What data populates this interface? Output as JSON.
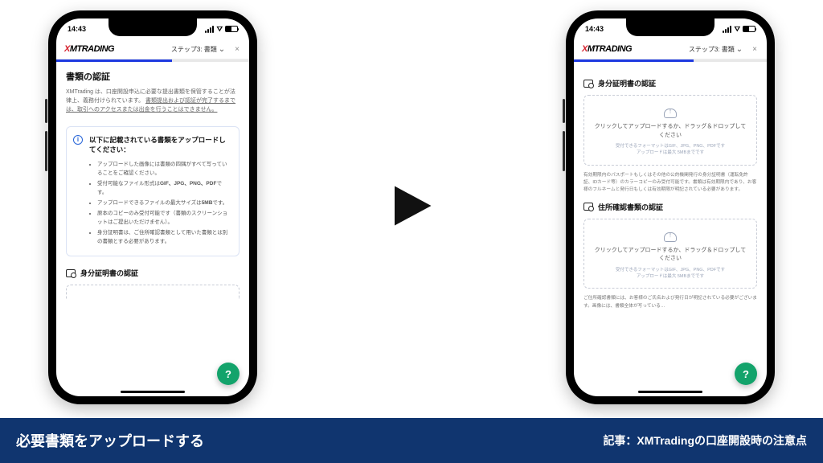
{
  "status": {
    "time": "14:43"
  },
  "header": {
    "brandA": "X",
    "brandB": "MTRADING",
    "step": "ステップ3: 書類",
    "close": "×"
  },
  "progress": {
    "pct1": "60%",
    "pct2": "62%"
  },
  "p1": {
    "title": "書類の認証",
    "lead_a": "XMTrading は、口座開設申込に必要な提出書類を保管することが法律上、義務付けられています。",
    "lead_b": "書類提出および認証が完了するまでは、取引へのアクセスまたは出金を行うことはできません。",
    "info_title": "以下に記載されている書類をアップロードしてください：",
    "b1": "アップロードした画像には書類の四隅がすべて写っていることをご確認ください。",
    "b2_a": "受付可能なファイル形式は",
    "b2_b": "GIF、JPG、PNG、PDF",
    "b2_c": "です。",
    "b3_a": "アップロードできるファイルの最大サイズは",
    "b3_b": "5MB",
    "b3_c": "です。",
    "b4": "原本のコピーのみ受付可能です（書類のスクリーンショットはご提出いただけません）。",
    "b5": "身分証明書は、ご住所確認書類として用いた書類とは別の書類とする必要があります。",
    "section1": "身分証明書の認証"
  },
  "p2": {
    "section1": "身分証明書の認証",
    "drop_label": "クリックしてアップロードするか、ドラッグ＆ドロップしてください",
    "drop_sub": "受付できるフォーマットはGIF、JPG、PNG、PDFです\nアップロードは最大 5MBまでです",
    "note1": "有効期限内のパスポートもしくはその他の公的機関発行の身分証明書（運転免許証、IDカード等）のカラーコピーのみ受付可能です。書類は有効期限内であり、お客様のフルネームと発行日もしくは有効期限が明記されている必要があります。",
    "section2": "住所確認書類の認証",
    "cut": "ご住所確認書類には、お客様のご氏名および発行日が明記されている必要がございます。画像には、書類全体が写っている…"
  },
  "fab": "?",
  "banner": {
    "left": "必要書類をアップロードする",
    "right": "記事：XMTradingの口座開設時の注意点"
  }
}
